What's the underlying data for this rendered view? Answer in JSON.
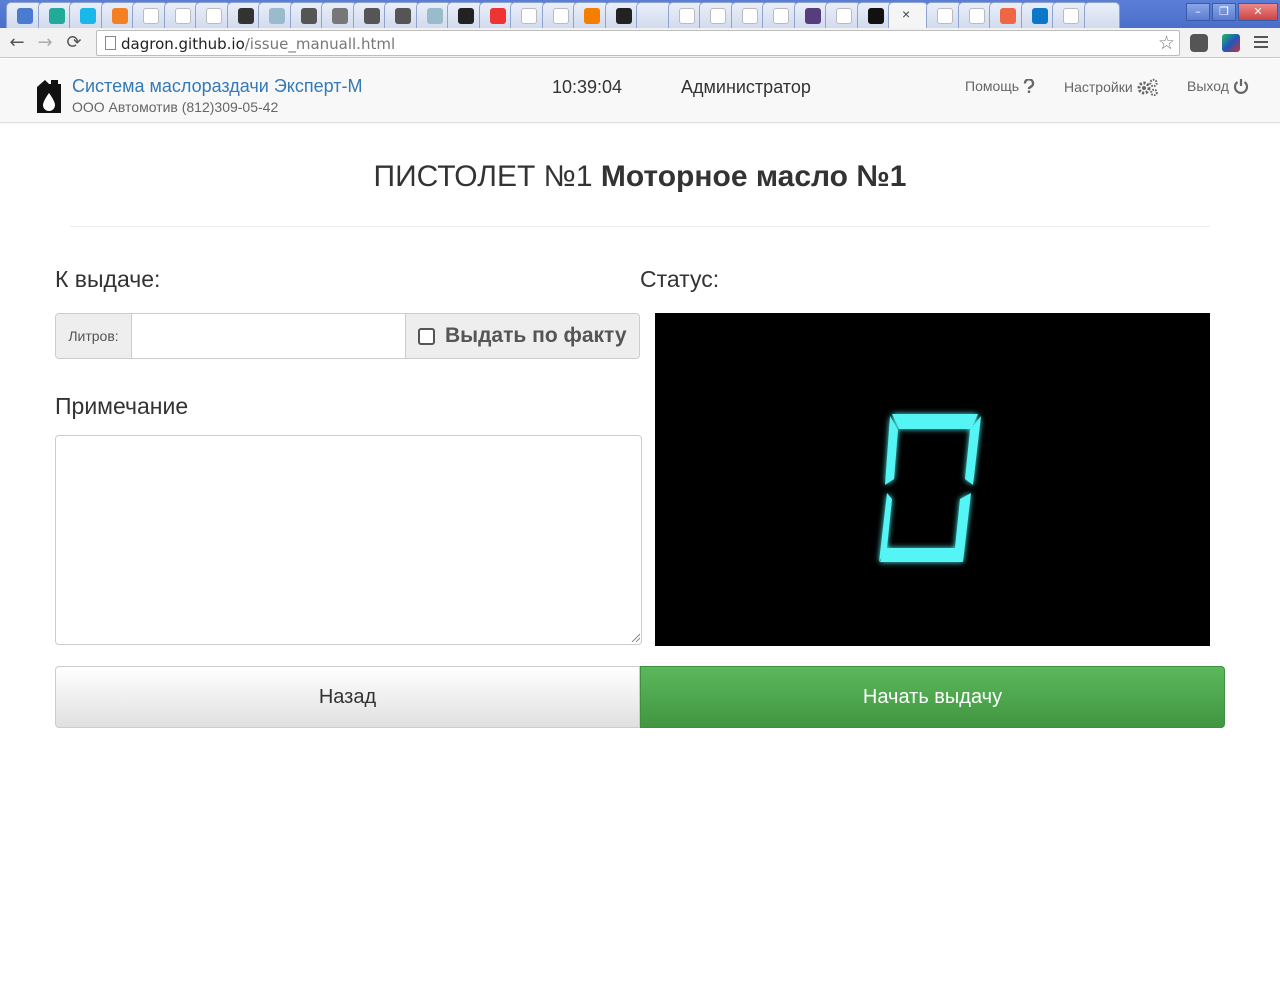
{
  "browser": {
    "url_host": "dagron.github.io",
    "url_path": "/issue_manuall.html",
    "active_tab_close": "×",
    "window_controls": [
      "👤",
      "–",
      "❐",
      "✕"
    ],
    "tab_icons": [
      "mail-icon",
      "leaf-icon",
      "vimeo-icon",
      "stackoverflow-icon",
      "google-icon",
      "rp-icon",
      "wp-icon",
      "t-icon",
      "h-icon",
      "book-icon",
      "pe-icon",
      "book-icon",
      "book-icon",
      "h-icon",
      "github-icon",
      "sync-icon",
      "rp-icon",
      "page-icon",
      "blogger-icon",
      "github-icon",
      "blank-icon",
      "page-icon",
      "gmail-icon",
      "page-icon",
      "google-icon",
      "bootstrap-icon",
      "google-icon",
      "flag-icon",
      "active-tab",
      "page-icon",
      "google-icon",
      "ask-icon",
      "drupal-icon",
      "linux-icon",
      "blank-icon"
    ]
  },
  "navbar": {
    "title": "Система маслораздачи Эксперт-М",
    "subtitle": "ООО Автомотив (812)309-05-42",
    "time": "10:39:04",
    "user": "Администратор",
    "help_label": "Помощь",
    "settings_label": "Настройки",
    "logout_label": "Выход"
  },
  "page": {
    "title_prefix": "ПИСТОЛЕТ №1",
    "title_product": "Моторное масло №1",
    "issue_label": "К выдаче:",
    "liters_addon": "Литров:",
    "liters_value": "",
    "fact_checkbox_label": "Выдать по факту",
    "fact_checked": false,
    "note_label": "Примечание",
    "note_value": "",
    "status_label": "Статус:",
    "status_display": "0",
    "display_color": "#55f5f5",
    "back_button": "Назад",
    "start_button": "Начать выдачу",
    "start_color": "#4cae4c"
  }
}
